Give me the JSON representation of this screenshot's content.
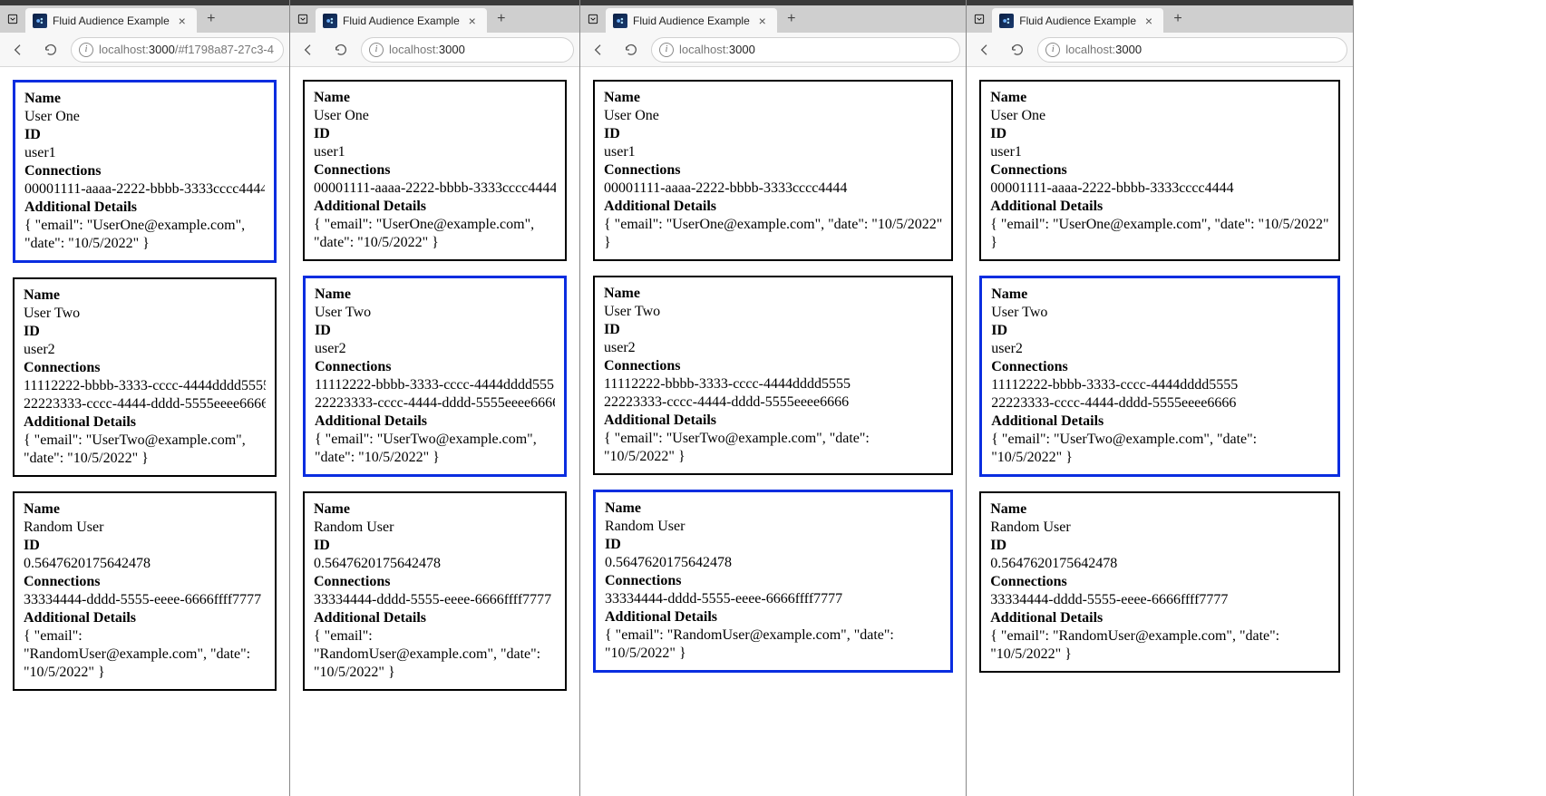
{
  "windows": [
    {
      "tab_title": "Fluid Audience Example",
      "url_host": "localhost:",
      "url_port": "3000",
      "url_path": "/#f1798a87-27c3-4",
      "show_fwd": false,
      "selected_card": 0
    },
    {
      "tab_title": "Fluid Audience Example",
      "url_host": "localhost:",
      "url_port": "3000",
      "url_path": "",
      "show_fwd": false,
      "selected_card": 1
    },
    {
      "tab_title": "Fluid Audience Example",
      "url_host": "localhost:",
      "url_port": "3000",
      "url_path": "",
      "show_fwd": false,
      "selected_card": 2
    },
    {
      "tab_title": "Fluid Audience Example",
      "url_host": "localhost:",
      "url_port": "3000",
      "url_path": "",
      "show_fwd": false,
      "selected_card": 1
    }
  ],
  "labels": {
    "name": "Name",
    "id": "ID",
    "connections": "Connections",
    "details": "Additional Details"
  },
  "cards": [
    {
      "name": "User One",
      "id": "user1",
      "connections": [
        "00001111-aaaa-2222-bbbb-3333cccc4444"
      ],
      "details": "{ \"email\": \"UserOne@example.com\", \"date\": \"10/5/2022\" }"
    },
    {
      "name": "User Two",
      "id": "user2",
      "connections": [
        "11112222-bbbb-3333-cccc-4444dddd5555",
        "22223333-cccc-4444-dddd-5555eeee6666"
      ],
      "details": "{ \"email\": \"UserTwo@example.com\", \"date\": \"10/5/2022\" }"
    },
    {
      "name": "Random User",
      "id": "0.5647620175642478",
      "connections": [
        "33334444-dddd-5555-eeee-6666ffff7777"
      ],
      "details": "{ \"email\": \"RandomUser@example.com\", \"date\": \"10/5/2022\" }"
    }
  ]
}
